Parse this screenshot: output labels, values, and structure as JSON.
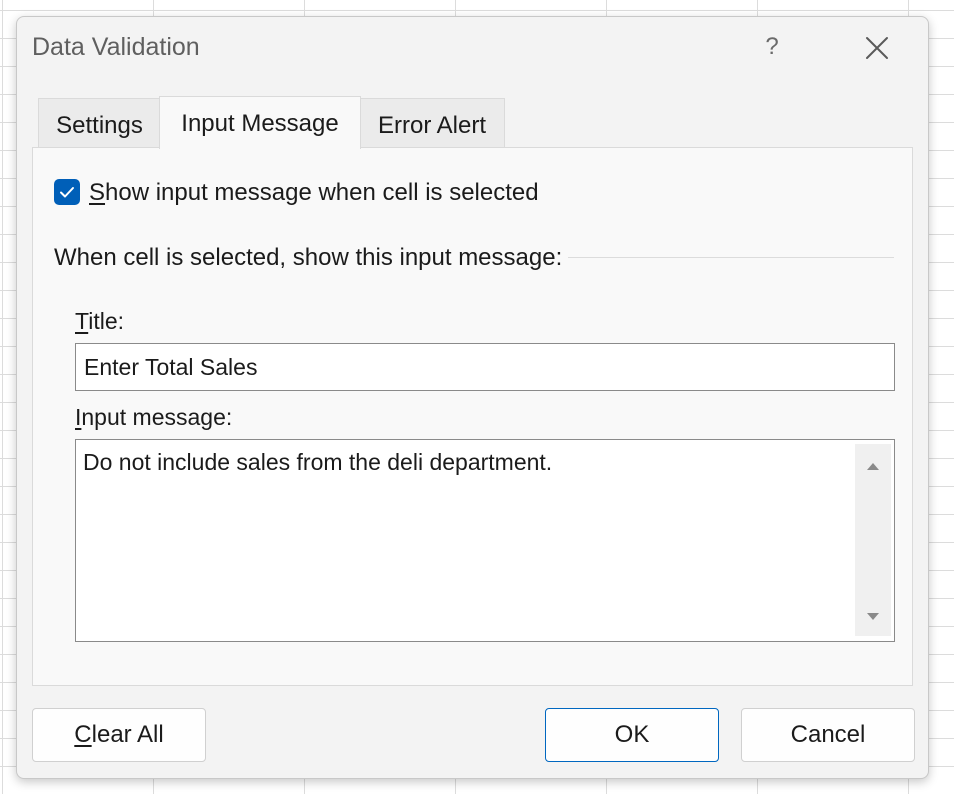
{
  "dialog": {
    "title": "Data Validation",
    "help_label": "?"
  },
  "tabs": [
    {
      "label": "Settings",
      "active": false
    },
    {
      "label": "Input Message",
      "active": true
    },
    {
      "label": "Error Alert",
      "active": false
    }
  ],
  "input_message": {
    "show_checkbox_checked": true,
    "show_checkbox_label_mnemonic": "S",
    "show_checkbox_label_rest": "how input message when cell is selected",
    "group_label": "When cell is selected, show this input message:",
    "title_label_mnemonic": "T",
    "title_label_rest": "itle:",
    "title_value": "Enter Total Sales",
    "message_label_mnemonic": "I",
    "message_label_rest": "nput message:",
    "message_value": "Do not include sales from the deli department."
  },
  "buttons": {
    "clear_all_mnemonic": "C",
    "clear_all_rest": "lear All",
    "ok": "OK",
    "cancel": "Cancel"
  },
  "icons": {
    "help": "help-icon",
    "close": "close-icon",
    "checkbox": "checkmark-icon",
    "scroll_up": "scroll-up-arrow-icon",
    "scroll_down": "scroll-down-arrow-icon"
  },
  "colors": {
    "accent": "#005fb8",
    "ok_border": "#0067c0",
    "dialog_bg": "#f3f3f3",
    "panel_bg": "#f9f9f9"
  }
}
